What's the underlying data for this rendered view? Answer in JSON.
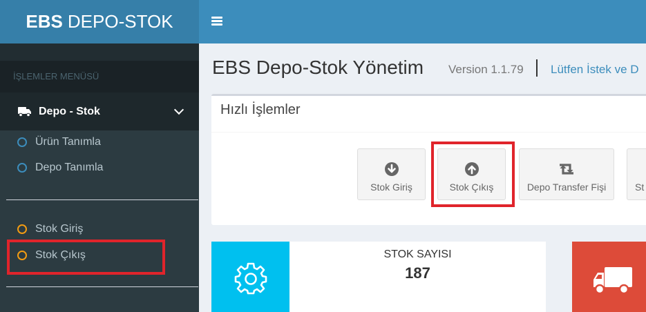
{
  "header": {
    "logo_bold": "EBS",
    "logo_rest": "DEPO-STOK"
  },
  "sidebar": {
    "menu_header": "İŞLEMLER MENÜSÜ",
    "treeview_label": "Depo - Stok",
    "items": [
      {
        "label": "Ürün Tanımla"
      },
      {
        "label": "Depo Tanımla"
      },
      {
        "label": "Stok Giriş"
      },
      {
        "label": "Stok Çıkış"
      }
    ]
  },
  "content": {
    "title": "EBS Depo-Stok Yönetim",
    "version": "Version 1.1.79",
    "separator": "|",
    "notice": "Lütfen İstek ve D",
    "quick_box": {
      "title": "Hızlı İşlemler",
      "buttons": [
        {
          "label": "Stok Giriş",
          "icon": "arrow-down-circle-icon"
        },
        {
          "label": "Stok Çıkış",
          "icon": "arrow-up-circle-icon"
        },
        {
          "label": "Depo Transfer Fişi",
          "icon": "retweet-icon"
        },
        {
          "label": "St"
        }
      ]
    },
    "info_box": {
      "text": "STOK SAYISI",
      "number": "187",
      "color": "#00c0ef"
    },
    "info_box2": {
      "color": "#dd4b39"
    }
  },
  "colors": {
    "header_logo": "#367fa9",
    "header_bar": "#3c8dbc",
    "sidebar": "#222d32",
    "highlight": "#e0242b"
  }
}
